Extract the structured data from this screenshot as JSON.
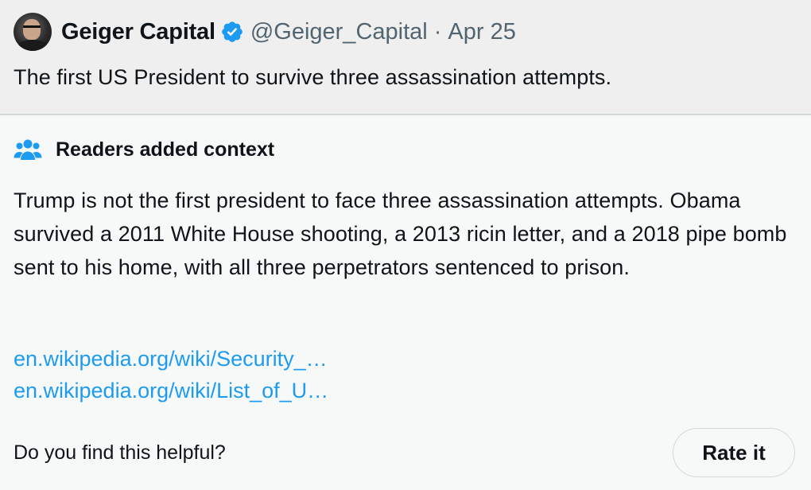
{
  "post": {
    "display_name": "Geiger Capital",
    "handle": "@Geiger_Capital",
    "separator": "·",
    "date": "Apr 25",
    "text": "The first US President to survive three assassination attempts.",
    "avatar_icon": "profile-photo",
    "verified_icon": "verified-badge-icon",
    "verified_color": "#1d9bf0"
  },
  "note": {
    "icon": "people-icon",
    "icon_color": "#1d9bf0",
    "title": "Readers added context",
    "body": "Trump is not the first president to face three assassination attempts. Obama survived a 2011 White House shooting, a 2013 ricin letter, and a 2018 pipe bomb sent to his home, with all three perpetrators sentenced to prison.",
    "links": [
      "en.wikipedia.org/wiki/Security_…",
      "en.wikipedia.org/wiki/List_of_U…"
    ],
    "link_color": "#1d9bf0",
    "helpful_question": "Do you find this helpful?",
    "rate_button": "Rate it"
  },
  "colors": {
    "post_background": "#efefef",
    "note_background": "#f7f9f9",
    "secondary_text": "#536471",
    "primary_text": "#0f1419"
  }
}
